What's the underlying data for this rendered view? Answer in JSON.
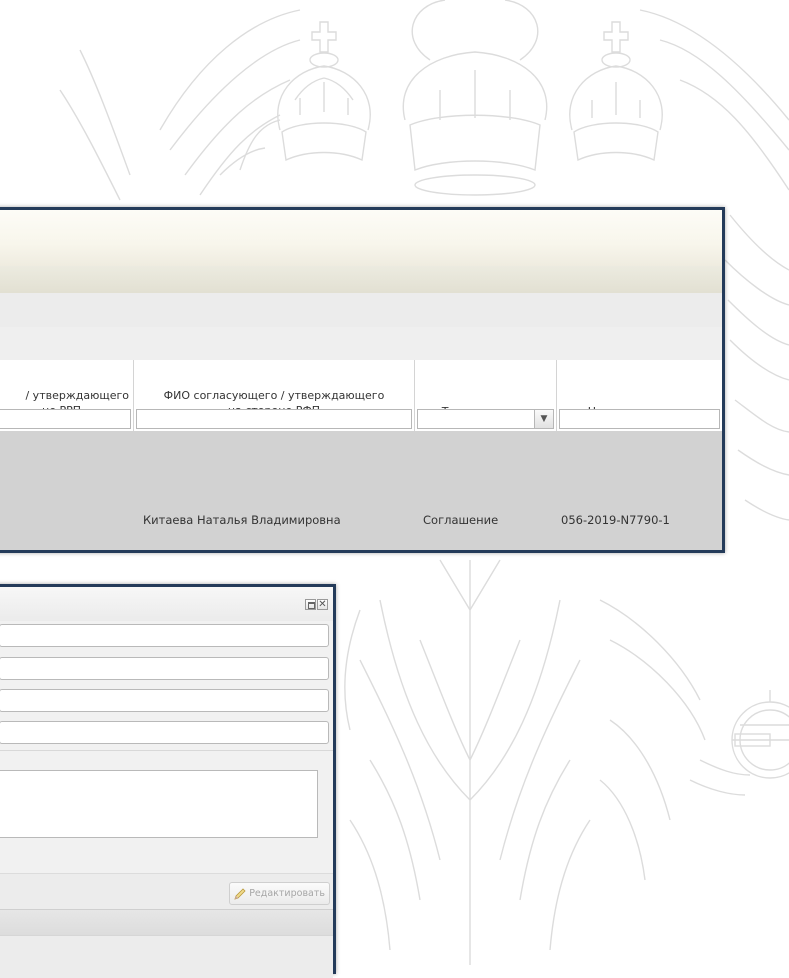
{
  "grid": {
    "columns": [
      {
        "title_line1": "/ утверждающего",
        "title_line2": "не РРП"
      },
      {
        "title_line1": "ФИО согласующего / утверждающего",
        "title_line2": "на стороне РФП"
      },
      {
        "title": "Тип документа"
      },
      {
        "title": "Номер документа"
      }
    ],
    "row": {
      "approver": "Китаева Наталья Владимировна",
      "doc_type": "Соглашение",
      "doc_number": "056-2019-N7790-1"
    }
  },
  "form": {
    "edit_label": "Редактировать"
  },
  "icons": {
    "combo": "chevron-down-icon",
    "maximize": "maximize-icon",
    "close": "close-icon",
    "edit": "pencil-icon"
  },
  "colors": {
    "window_border": "#243b5a",
    "selected_row": "#d2d2d2"
  }
}
